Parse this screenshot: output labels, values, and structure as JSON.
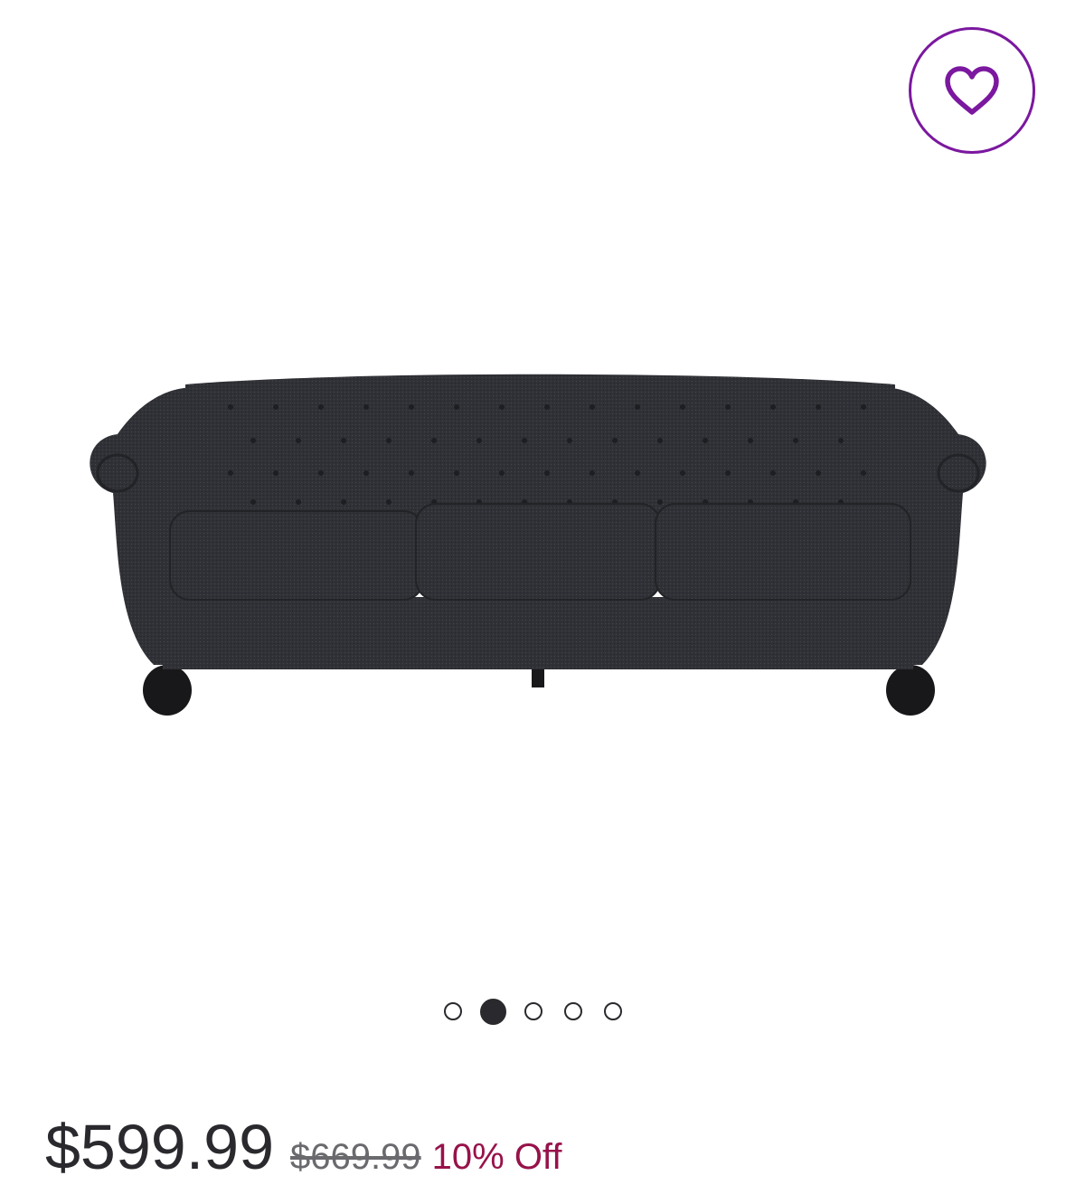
{
  "favorite": {
    "icon": "heart-outline-icon",
    "color": "#7b189f"
  },
  "product": {
    "image_icon": "sofa-image",
    "sofa_color": "#2f3034"
  },
  "carousel": {
    "count": 5,
    "active_index": 1
  },
  "pricing": {
    "current": "$599.99",
    "original": "$669.99",
    "discount": "10% Off",
    "discount_color": "#97124a"
  }
}
